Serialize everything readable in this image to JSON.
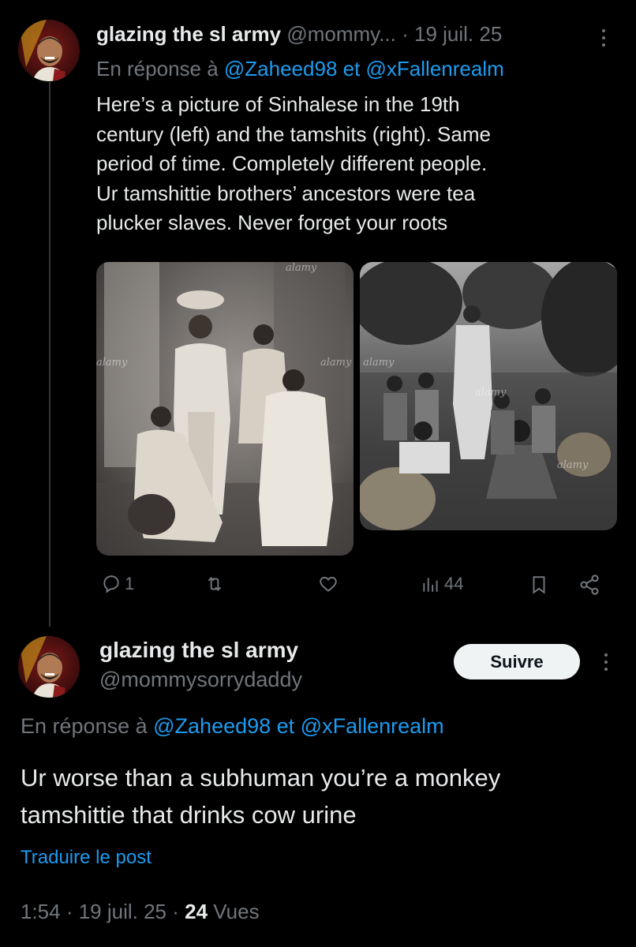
{
  "tweet1": {
    "display_name": "glazing the sl army",
    "handle_date": "@mommy... · 19 juil. 25",
    "reply_prefix": "En réponse à",
    "reply_users": "@Zaheed98 et @xFallenrealm",
    "text": "Here’s a picture of Sinhalese in the 19th\ncentury (left) and the tamshits (right). Same\nperiod of time. Completely different people.\nUr tamshittie brothers’ ancestors were tea\nplucker slaves. Never forget your roots",
    "watermark": "alamy",
    "actions": {
      "replies": "1",
      "reposts": "",
      "likes": "",
      "views": "44"
    }
  },
  "tweet2": {
    "display_name": "glazing the sl army",
    "handle": "@mommysorrydaddy",
    "follow_label": "Suivre",
    "reply_prefix": "En réponse à",
    "reply_users": "@Zaheed98 et @xFallenrealm",
    "text": "Ur worse than a subhuman you’re a monkey\ntamshittie that drinks cow urine",
    "translate_label": "Traduire le post",
    "meta_time": "1:54 · 19 juil. 25 · ",
    "views_count": "24",
    "views_label": " Vues"
  },
  "icons": [
    "more-icon",
    "reply-icon",
    "repost-icon",
    "like-icon",
    "views-icon",
    "bookmark-icon",
    "share-icon"
  ],
  "colors": {
    "background": "#000000",
    "text": "#e7e9ea",
    "secondary": "#71767b",
    "link": "#1d9bf0",
    "button": "#eff3f4"
  }
}
